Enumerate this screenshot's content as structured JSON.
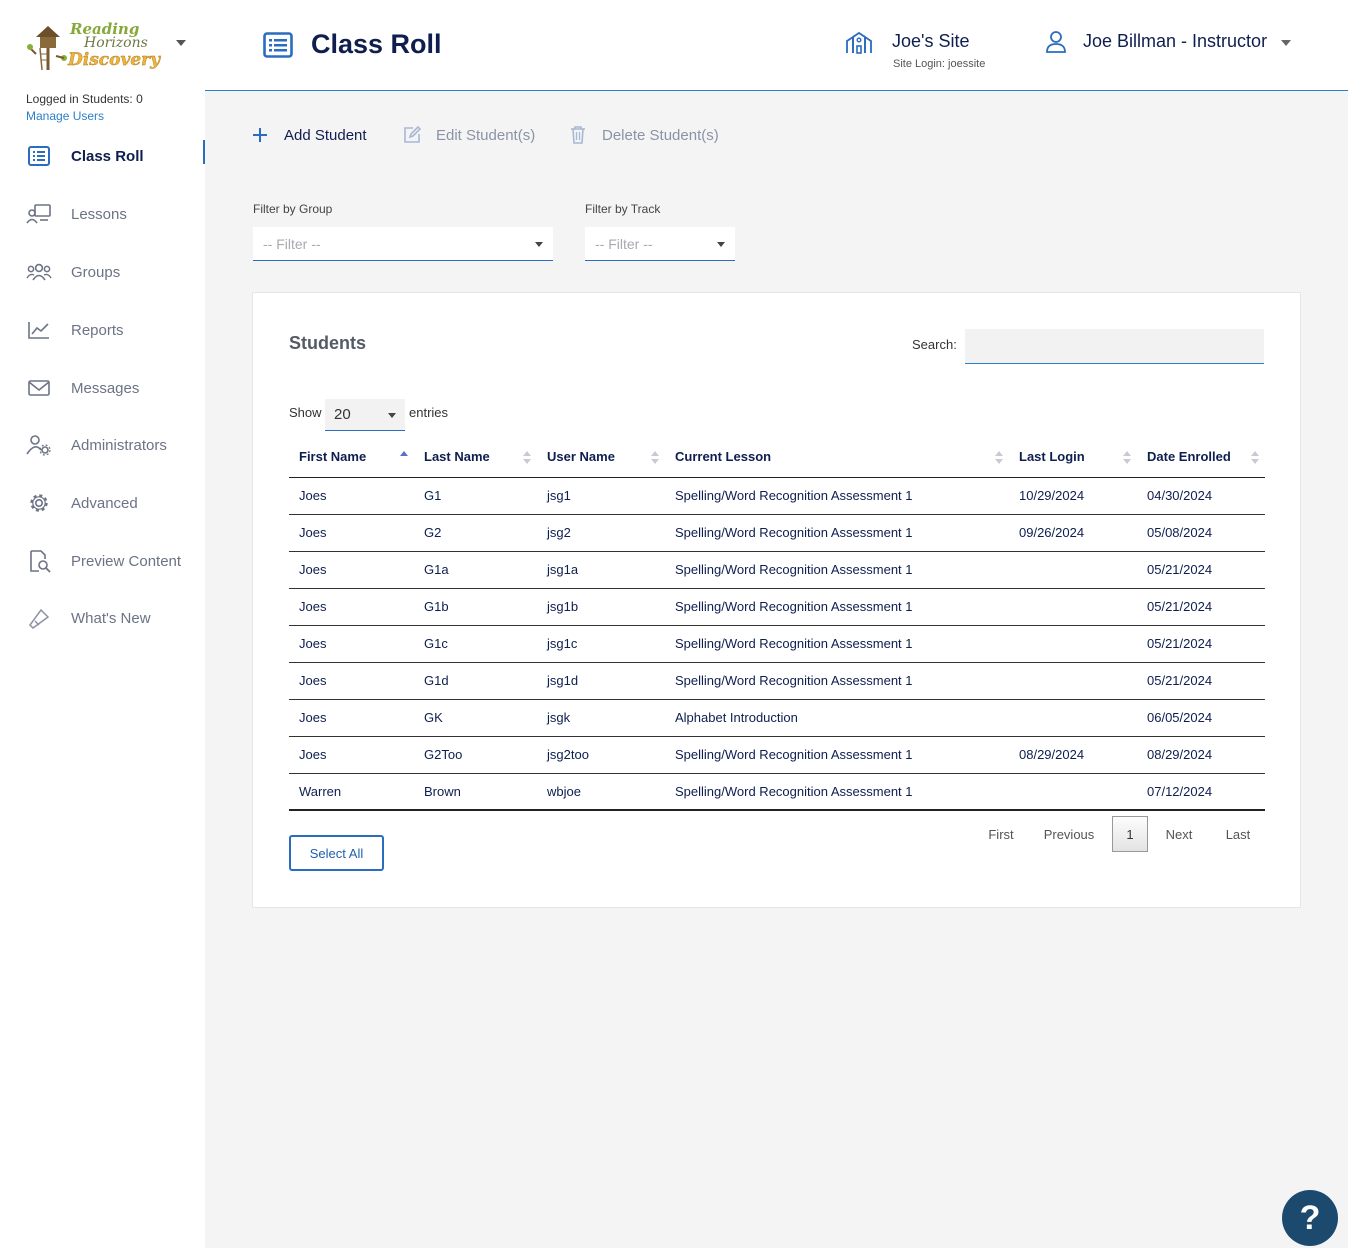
{
  "sidebar": {
    "logo_line1": "Reading",
    "logo_line2": "Horizons",
    "logo_line3": "Discovery",
    "logged_in": "Logged in Students: 0",
    "manage_users": "Manage Users",
    "items": [
      {
        "label": "Class Roll",
        "icon": "list-icon",
        "active": true
      },
      {
        "label": "Lessons",
        "icon": "lessons-icon"
      },
      {
        "label": "Groups",
        "icon": "groups-icon"
      },
      {
        "label": "Reports",
        "icon": "chart-icon"
      },
      {
        "label": "Messages",
        "icon": "envelope-icon"
      },
      {
        "label": "Administrators",
        "icon": "admin-icon"
      },
      {
        "label": "Advanced",
        "icon": "gear-icon"
      },
      {
        "label": "Preview Content",
        "icon": "preview-icon"
      },
      {
        "label": "What's New",
        "icon": "megaphone-icon"
      }
    ]
  },
  "header": {
    "title": "Class Roll",
    "site_name": "Joe's Site",
    "site_login": "Site Login: joessite",
    "user_name": "Joe Billman - Instructor"
  },
  "toolbar": {
    "add": "Add Student",
    "edit": "Edit Student(s)",
    "delete": "Delete Student(s)"
  },
  "filters": {
    "group_label": "Filter by Group",
    "group_placeholder": "-- Filter --",
    "track_label": "Filter by Track",
    "track_placeholder": "-- Filter --"
  },
  "students": {
    "title": "Students",
    "search_label": "Search:",
    "show_label": "Show",
    "show_value": "20",
    "entries_label": "entries",
    "columns": [
      "First Name",
      "Last Name",
      "User Name",
      "Current Lesson",
      "Last Login",
      "Date Enrolled"
    ],
    "rows": [
      [
        "Joes",
        "G1",
        "jsg1",
        "Spelling/Word Recognition Assessment 1",
        "10/29/2024",
        "04/30/2024"
      ],
      [
        "Joes",
        "G2",
        "jsg2",
        "Spelling/Word Recognition Assessment 1",
        "09/26/2024",
        "05/08/2024"
      ],
      [
        "Joes",
        "G1a",
        "jsg1a",
        "Spelling/Word Recognition Assessment 1",
        "",
        "05/21/2024"
      ],
      [
        "Joes",
        "G1b",
        "jsg1b",
        "Spelling/Word Recognition Assessment 1",
        "",
        "05/21/2024"
      ],
      [
        "Joes",
        "G1c",
        "jsg1c",
        "Spelling/Word Recognition Assessment 1",
        "",
        "05/21/2024"
      ],
      [
        "Joes",
        "G1d",
        "jsg1d",
        "Spelling/Word Recognition Assessment 1",
        "",
        "05/21/2024"
      ],
      [
        "Joes",
        "GK",
        "jsgk",
        "Alphabet Introduction",
        "",
        "06/05/2024"
      ],
      [
        "Joes",
        "G2Too",
        "jsg2too",
        "Spelling/Word Recognition Assessment 1",
        "08/29/2024",
        "08/29/2024"
      ],
      [
        "Warren",
        "Brown",
        "wbjoe",
        "Spelling/Word Recognition Assessment 1",
        "",
        "07/12/2024"
      ]
    ],
    "select_all": "Select All",
    "pager": {
      "first": "First",
      "previous": "Previous",
      "current": "1",
      "next": "Next",
      "last": "Last"
    }
  },
  "help": "?"
}
